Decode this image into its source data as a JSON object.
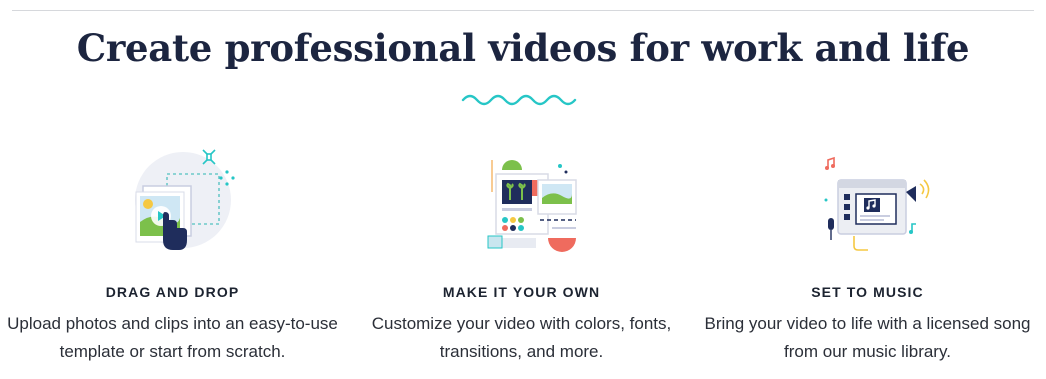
{
  "header": {
    "title": "Create professional videos for work and life"
  },
  "features": [
    {
      "heading": "DRAG AND DROP",
      "description": "Upload photos and clips into an easy-to-use template or start from scratch.",
      "icon": "drag-and-drop-illustration"
    },
    {
      "heading": "MAKE IT YOUR OWN",
      "description": "Customize your video with colors, fonts, transitions, and more.",
      "icon": "customize-illustration"
    },
    {
      "heading": "SET TO MUSIC",
      "description": "Bring your video to life with a licensed song from our music library.",
      "icon": "music-illustration"
    }
  ],
  "colors": {
    "title": "#1c2540",
    "accent_teal": "#26c6c6",
    "navy": "#1f2d5c",
    "green": "#7cc04b",
    "coral": "#ef6b5e",
    "yellow": "#f5c842"
  }
}
